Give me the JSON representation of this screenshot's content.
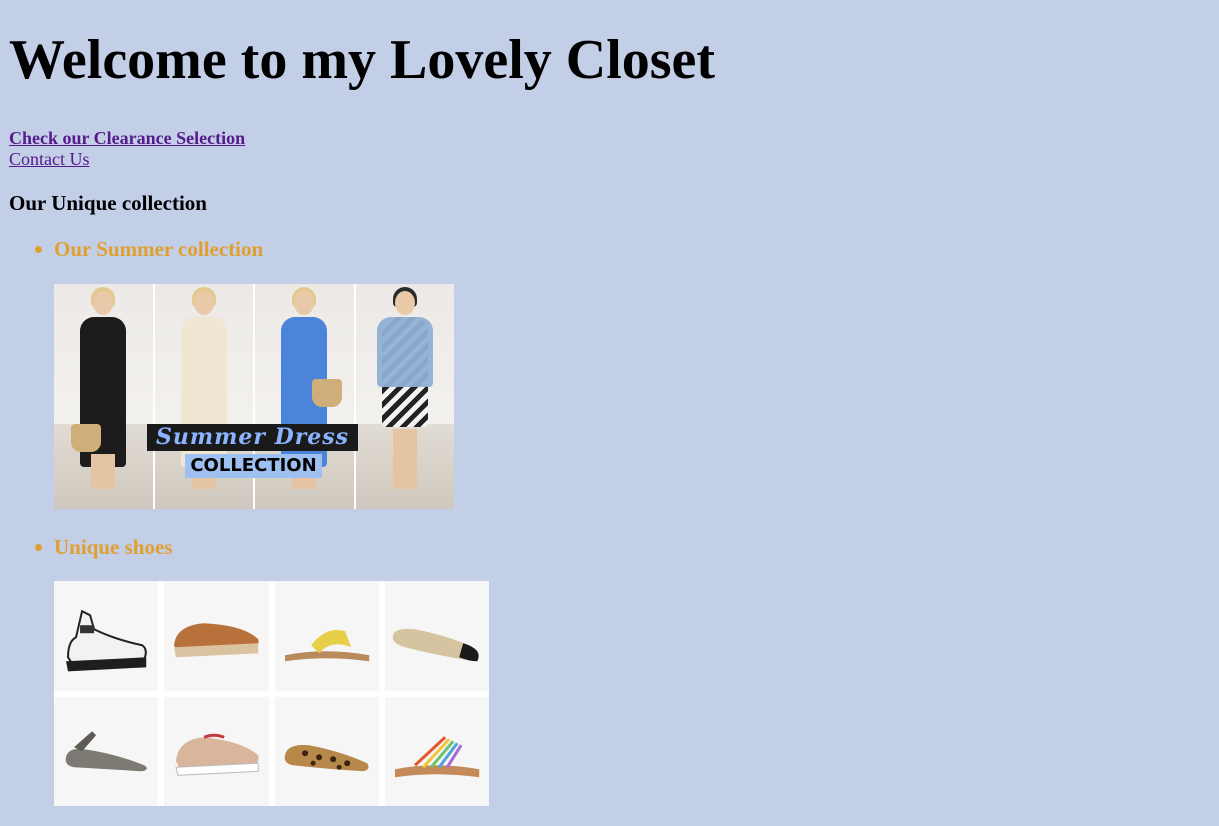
{
  "page": {
    "title": "Welcome to my Lovely Closet",
    "clearance_link": "Check our Clearance Selection",
    "contact_link": "Contact Us",
    "section_heading": "Our Unique collection"
  },
  "collections": [
    {
      "title": "Our Summer collection",
      "banner_line1": "Summer Dress",
      "banner_line2": "COLLECTION"
    },
    {
      "title": "Unique shoes"
    }
  ],
  "colors": {
    "background": "#c3cee7",
    "link": "#551a8b",
    "item_title": "#e0a030"
  }
}
